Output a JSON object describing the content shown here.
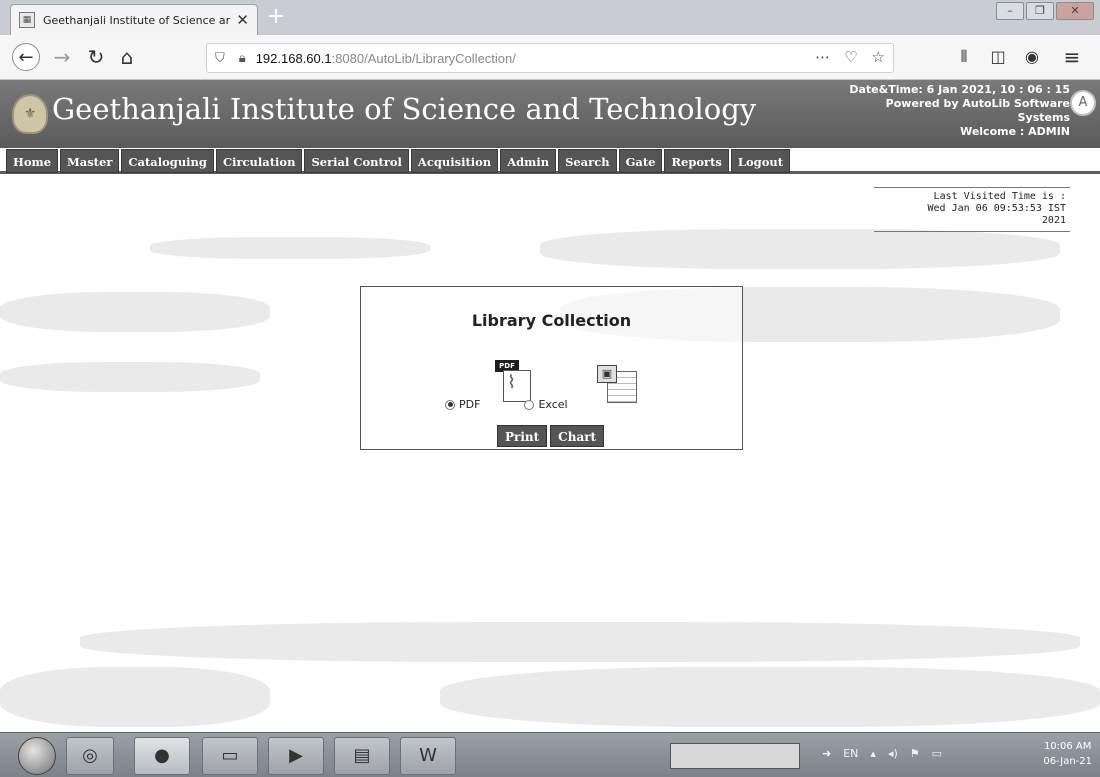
{
  "browser": {
    "tab_title": "Geethanjali Institute of Science and Technology",
    "url_host": "192.168.60.1",
    "url_rest": ":8080/AutoLib/LibraryCollection/"
  },
  "header": {
    "institution_name": "Geethanjali Institute of Science and Technology",
    "datetime_line": "Date&Time:   6 Jan 2021, 10 : 06 : 15",
    "powered_line1": "Powered by AutoLib Software",
    "powered_line2": "Systems",
    "welcome_line": "Welcome   :   ADMIN"
  },
  "menu": {
    "items": [
      "Home",
      "Master",
      "Cataloguing",
      "Circulation",
      "Serial Control",
      "Acquisition",
      "Admin",
      "Search",
      "Gate",
      "Reports",
      "Logout"
    ]
  },
  "last_visited": {
    "label": "Last Visited Time is :",
    "value_line1": "Wed Jan 06 09:53:53 IST",
    "value_line2": "2021"
  },
  "collection_panel": {
    "title": "Library Collection",
    "pdf_icon_tag": "PDF",
    "options": [
      {
        "label": "PDF",
        "selected": true
      },
      {
        "label": "Excel",
        "selected": false
      }
    ],
    "print_label": "Print",
    "chart_label": "Chart"
  },
  "taskbar": {
    "language": "EN",
    "clock_time": "10:06 AM",
    "clock_date": "06-Jan-21"
  },
  "icons": {
    "back": "back-arrow-icon",
    "forward": "forward-arrow-icon",
    "reload": "reload-icon",
    "home": "home-icon",
    "bookmark": "star-icon",
    "library": "library-icon",
    "menu": "hamburger-icon"
  }
}
